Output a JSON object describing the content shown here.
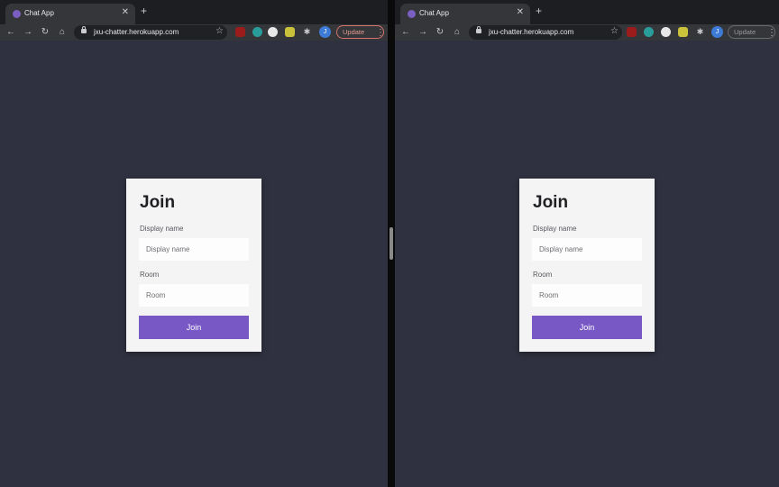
{
  "colors": {
    "page_background": "#2f3140",
    "card_background": "#f4f4f5",
    "accent": "#7858c4",
    "update_button": "#d5746a"
  },
  "windows": [
    {
      "tab_title": "Chat App",
      "url": "jxu-chatter.herokuapp.com",
      "update_label": "Update",
      "profile_initial": "J",
      "card": {
        "title": "Join",
        "display_name_label": "Display name",
        "display_name_placeholder": "Display name",
        "display_name_value": "",
        "room_label": "Room",
        "room_placeholder": "Room",
        "room_value": "",
        "join_label": "Join"
      }
    },
    {
      "tab_title": "Chat App",
      "url": "jxu-chatter.herokuapp.com",
      "update_label": "Update",
      "profile_initial": "J",
      "card": {
        "title": "Join",
        "display_name_label": "Display name",
        "display_name_placeholder": "Display name",
        "display_name_value": "",
        "room_label": "Room",
        "room_placeholder": "Room",
        "room_value": "",
        "join_label": "Join"
      }
    }
  ],
  "icons": {
    "nav": [
      "back-arrow-icon",
      "forward-arrow-icon",
      "reload-icon",
      "home-icon"
    ],
    "extensions": [
      "ublock-icon",
      "extension-teal-icon",
      "extension-dark-icon",
      "extension-yellow-icon",
      "puzzle-icon"
    ]
  }
}
